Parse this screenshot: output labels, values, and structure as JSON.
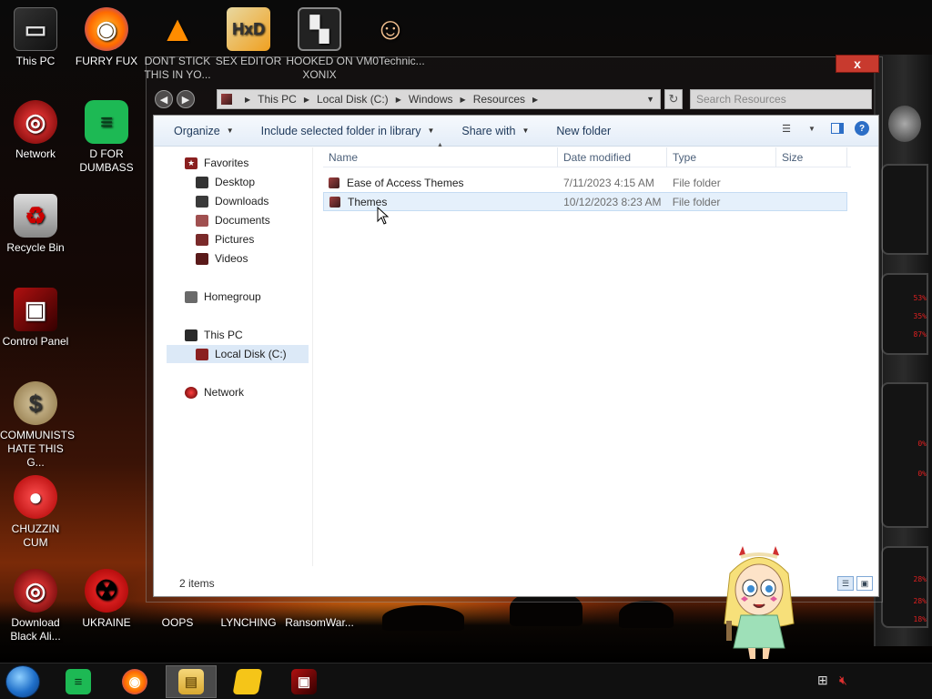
{
  "desktop_icons": [
    {
      "label": "This PC",
      "icon": "computer-icon"
    },
    {
      "label": "FURRY FUX",
      "icon": "firefox-icon"
    },
    {
      "label": "DONT STICK THIS IN YO...",
      "icon": "vlc-cone-icon"
    },
    {
      "label": "SEX EDITOR",
      "icon": "hxd-hex-editor-icon"
    },
    {
      "label": "HOOKED ON XONIX",
      "icon": "xonix-game-icon"
    },
    {
      "label": "VM0Technic...",
      "icon": "doctor-person-icon"
    },
    {
      "label": "Network",
      "icon": "network-globe-icon"
    },
    {
      "label": "D FOR DUMBASS",
      "icon": "green-document-icon"
    },
    {
      "label": "Recycle Bin",
      "icon": "recycle-bin-icon"
    },
    {
      "label": "Control Panel",
      "icon": "control-panel-icon"
    },
    {
      "label": "COMMUNISTS HATE THIS G...",
      "icon": "money-bag-icon"
    },
    {
      "label": "CHUZZIN CUM",
      "icon": "red-chuzzle-icon"
    },
    {
      "label": "Download Black Ali...",
      "icon": "alien-globe-icon"
    },
    {
      "label": "UKRAINE",
      "icon": "radiation-icon"
    },
    {
      "label": "OOPS",
      "icon": "oops-icon"
    },
    {
      "label": "LYNCHING",
      "icon": "lynching-icon"
    },
    {
      "label": "RansomWar...",
      "icon": "ransomware-icon"
    }
  ],
  "window": {
    "close_label": "x"
  },
  "address": {
    "crumbs": [
      "This PC",
      "Local Disk (C:)",
      "Windows",
      "Resources"
    ],
    "search_placeholder": "Search Resources"
  },
  "toolbar": {
    "organize": "Organize",
    "include_library": "Include selected folder in library",
    "share_with": "Share with",
    "new_folder": "New folder",
    "help": "?"
  },
  "nav": {
    "favorites": "Favorites",
    "desktop": "Desktop",
    "downloads": "Downloads",
    "documents": "Documents",
    "pictures": "Pictures",
    "videos": "Videos",
    "homegroup": "Homegroup",
    "this_pc": "This PC",
    "local_disk": "Local Disk (C:)",
    "network": "Network"
  },
  "columns": {
    "name": "Name",
    "date": "Date modified",
    "type": "Type",
    "size": "Size"
  },
  "files": [
    {
      "name": "Ease of Access Themes",
      "date": "7/11/2023 4:15 AM",
      "type": "File folder",
      "size": ""
    },
    {
      "name": "Themes",
      "date": "10/12/2023 8:23 AM",
      "type": "File folder",
      "size": ""
    }
  ],
  "status": {
    "count": "2 items"
  },
  "hud": {
    "readouts": [
      "53%",
      "35%",
      "87%",
      "0%",
      "0%",
      "28%",
      "28%",
      "18%"
    ]
  },
  "taskbar": {
    "items": [
      "start-orb",
      "green-document-app",
      "firefox",
      "file-explorer",
      "sticky-notes",
      "control-panel"
    ],
    "active": "file-explorer"
  },
  "colors": {
    "accent": "#2c6ec6",
    "close": "#c83a2e",
    "selection": "#e5f0fb",
    "hud_text": "#e02020"
  }
}
